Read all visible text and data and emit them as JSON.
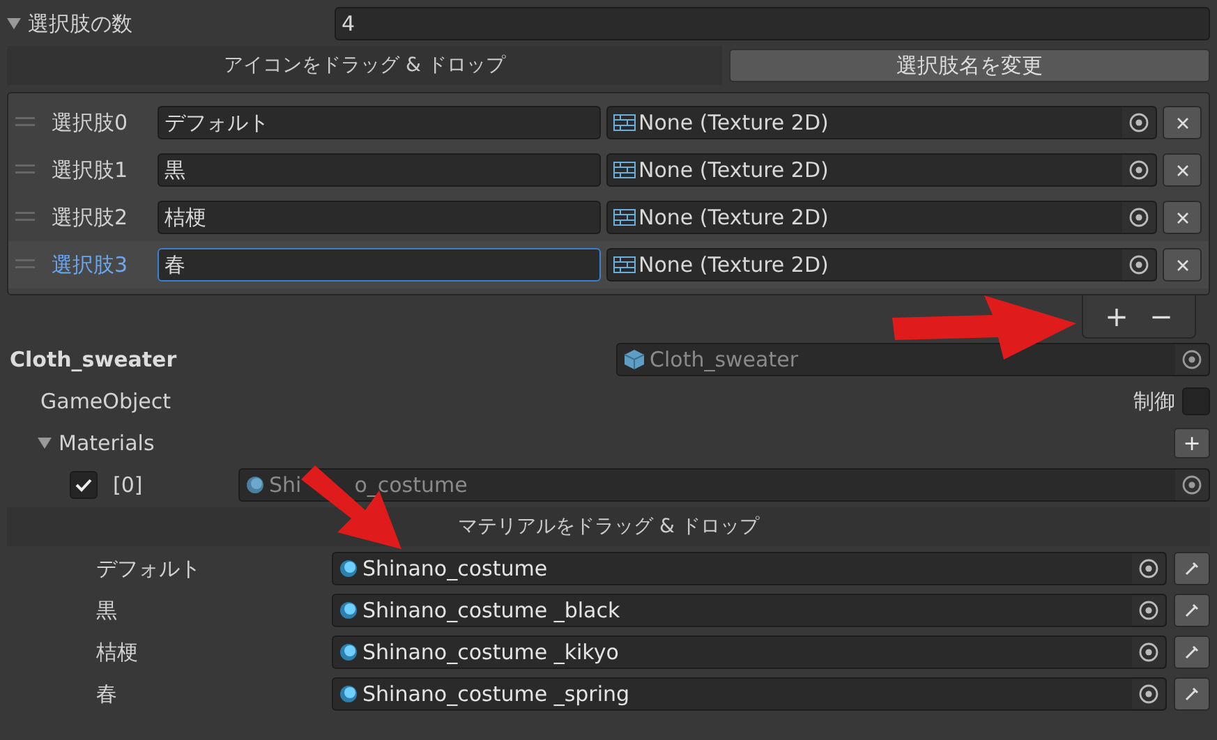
{
  "choice_count": {
    "label": "選択肢の数",
    "value": "4",
    "expanded": true
  },
  "icon_drop": {
    "label": "アイコンをドラッグ & ドロップ"
  },
  "rename_button": "選択肢名を変更",
  "choices": [
    {
      "label": "選択肢0",
      "name": "デフォルト",
      "texture": "None (Texture 2D)",
      "selected": false
    },
    {
      "label": "選択肢1",
      "name": "黒",
      "texture": "None (Texture 2D)",
      "selected": false
    },
    {
      "label": "選択肢2",
      "name": "桔梗",
      "texture": "None (Texture 2D)",
      "selected": false
    },
    {
      "label": "選択肢3",
      "name": "春",
      "texture": "None (Texture 2D)",
      "selected": true
    }
  ],
  "list_footer": {
    "add": "+",
    "remove": "−"
  },
  "object": {
    "title": "Cloth_sweater",
    "field": "Cloth_sweater"
  },
  "game_object": {
    "label": "GameObject",
    "control_label": "制御",
    "control_checked": false
  },
  "materials": {
    "label": "Materials",
    "expanded": true,
    "add": "+",
    "items": [
      {
        "index": "[0]",
        "checked": true,
        "value_start": "Shi",
        "value_end": "o_costume"
      }
    ]
  },
  "material_drop": "マテリアルをドラッグ & ドロップ",
  "material_choices": [
    {
      "label": "デフォルト",
      "material": "Shinano_costume"
    },
    {
      "label": "黒",
      "material": "Shinano_costume _black"
    },
    {
      "label": "桔梗",
      "material": "Shinano_costume _kikyo"
    },
    {
      "label": "春",
      "material": "Shinano_costume _spring"
    }
  ]
}
